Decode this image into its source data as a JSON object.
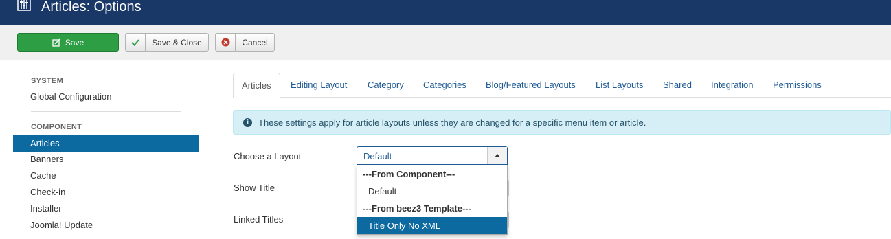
{
  "header": {
    "title": "Articles: Options",
    "icon": "options-sliders-icon"
  },
  "toolbar": {
    "save": "Save",
    "save_close": "Save & Close",
    "cancel": "Cancel"
  },
  "sidebar": {
    "system_head": "SYSTEM",
    "global_config": "Global Configuration",
    "component_head": "COMPONENT",
    "items": [
      "Articles",
      "Banners",
      "Cache",
      "Check-in",
      "Installer",
      "Joomla! Update"
    ],
    "active_index": 0
  },
  "tabs": [
    "Articles",
    "Editing Layout",
    "Category",
    "Categories",
    "Blog/Featured Layouts",
    "List Layouts",
    "Shared",
    "Integration",
    "Permissions"
  ],
  "alert": {
    "icon": "i",
    "text": "These settings apply for article layouts unless they are changed for a specific menu item or article."
  },
  "form": {
    "choose_layout_label": "Choose a Layout",
    "show_title_label": "Show Title",
    "linked_titles_label": "Linked Titles",
    "layout_value": "Default"
  },
  "dropdown": {
    "group1": "---From Component---",
    "opt1": "Default",
    "group2": "---From beez3 Template---",
    "opt2": "Title Only No XML"
  },
  "colors": {
    "header": "#1a3867",
    "save": "#2e9e44",
    "active": "#0d6aa1",
    "link": "#1f5a94",
    "alert": "#d6eef5"
  }
}
